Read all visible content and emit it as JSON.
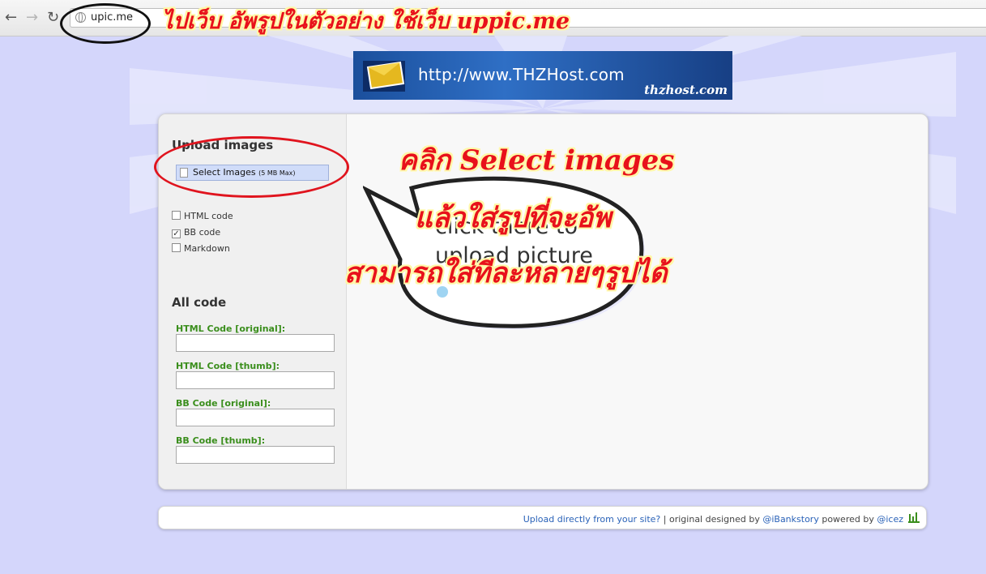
{
  "browser": {
    "url": "upic.me",
    "back_icon": "←",
    "forward_icon": "→",
    "reload_icon": "↻"
  },
  "annotations": {
    "top": "ไปเว็บ อัพรูปในตัวอย่าง ใช้เว็บ uppic.me",
    "click_select": "คลิก Select images",
    "insert_image": "แล้วใส่รูปที่จะอัพ",
    "multiple": "สามารถใส่ทีละหลายๆรูปได้"
  },
  "banner": {
    "url_text": "http://www.THZHost.com",
    "brand": "thzhost.com"
  },
  "upload": {
    "title": "Upload images",
    "select_button": "Select Images",
    "select_max": "(5 MB Max)",
    "options": [
      {
        "label": "HTML code",
        "checked": false
      },
      {
        "label": "BB code",
        "checked": true
      },
      {
        "label": "Markdown",
        "checked": false
      }
    ],
    "placeholder_lines": [
      "click there to",
      "upload picture"
    ]
  },
  "all_code": {
    "title": "All code",
    "fields": [
      {
        "label": "HTML Code [original]:",
        "value": ""
      },
      {
        "label": "HTML Code [thumb]:",
        "value": ""
      },
      {
        "label": "BB Code [original]:",
        "value": ""
      },
      {
        "label": "BB Code [thumb]:",
        "value": ""
      }
    ]
  },
  "footer": {
    "upload_link": "Upload directly from your site?",
    "separator": "|",
    "designed_by": "original designed by",
    "designer": "@iBankstory",
    "powered_by": "powered by",
    "powered": "@icez"
  }
}
